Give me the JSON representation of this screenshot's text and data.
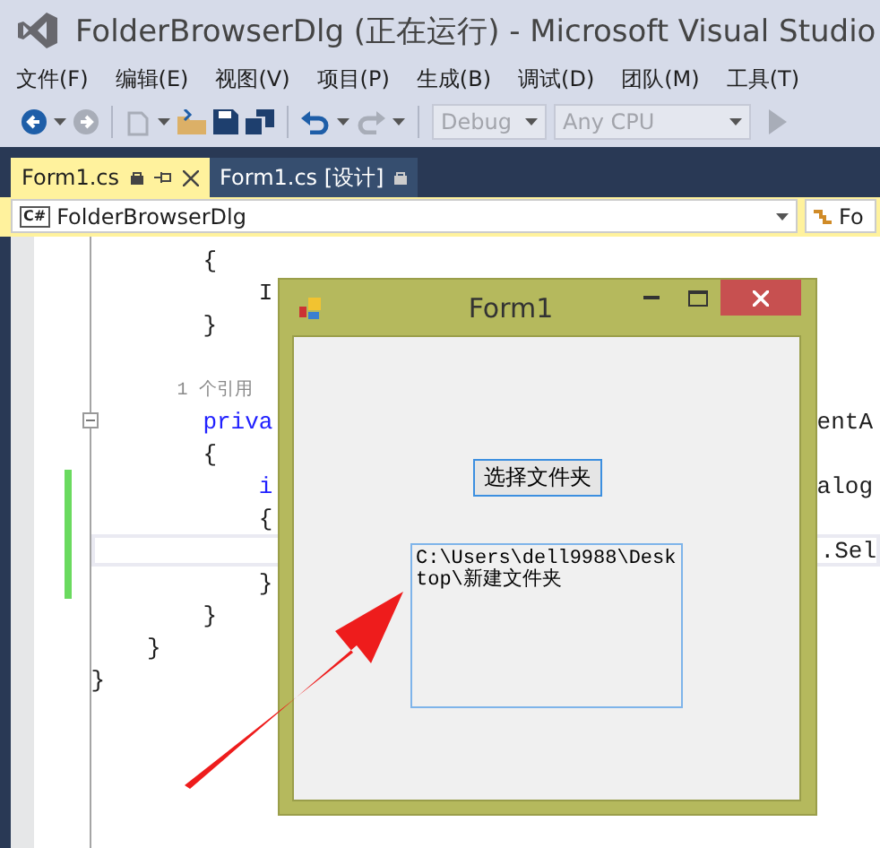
{
  "window": {
    "title": "FolderBrowserDlg (正在运行) - Microsoft Visual Studio"
  },
  "menu": [
    "文件(F)",
    "编辑(E)",
    "视图(V)",
    "项目(P)",
    "生成(B)",
    "调试(D)",
    "团队(M)",
    "工具(T)"
  ],
  "toolbar": {
    "configuration": "Debug",
    "platform": "Any CPU"
  },
  "tabs": [
    {
      "label": "Form1.cs",
      "selected": true
    },
    {
      "label": "Form1.cs [设计]",
      "selected": false
    }
  ],
  "nav_bar": {
    "class_icon_text": "C#",
    "type": "FolderBrowserDlg",
    "member": "Fo"
  },
  "code_lines": [
    {
      "kind": "code",
      "text": "        {",
      "changed": false,
      "current": false
    },
    {
      "kind": "code",
      "text": "            I",
      "changed": false,
      "current": false
    },
    {
      "kind": "code",
      "text": "        }",
      "changed": false,
      "current": false
    },
    {
      "kind": "code",
      "changed": false,
      "current": false
    },
    {
      "kind": "codelens",
      "text": "        1 个引用",
      "changed": false,
      "current": false
    },
    {
      "kind": "keyword",
      "text": "        priva",
      "right": "entA",
      "changed": false,
      "current": false
    },
    {
      "kind": "code",
      "text": "        {",
      "changed": false,
      "current": false
    },
    {
      "kind": "keyword",
      "text": "            i",
      "right": "alog",
      "changed": true,
      "current": false
    },
    {
      "kind": "code",
      "text": "            {",
      "changed": true,
      "current": false
    },
    {
      "kind": "code",
      "right": ".Sel",
      "changed": true,
      "current": true
    },
    {
      "kind": "code",
      "text": "            }",
      "changed": true,
      "current": false
    },
    {
      "kind": "code",
      "text": "        }",
      "changed": false,
      "current": false
    },
    {
      "kind": "code",
      "text": "    }",
      "changed": false,
      "current": false
    },
    {
      "kind": "code",
      "text": "}",
      "changed": false,
      "current": false
    }
  ],
  "form": {
    "title": "Form1",
    "button": "选择文件夹",
    "text_box": "C:\\Users\\dell9988\\Desktop\\新建文件夹"
  }
}
